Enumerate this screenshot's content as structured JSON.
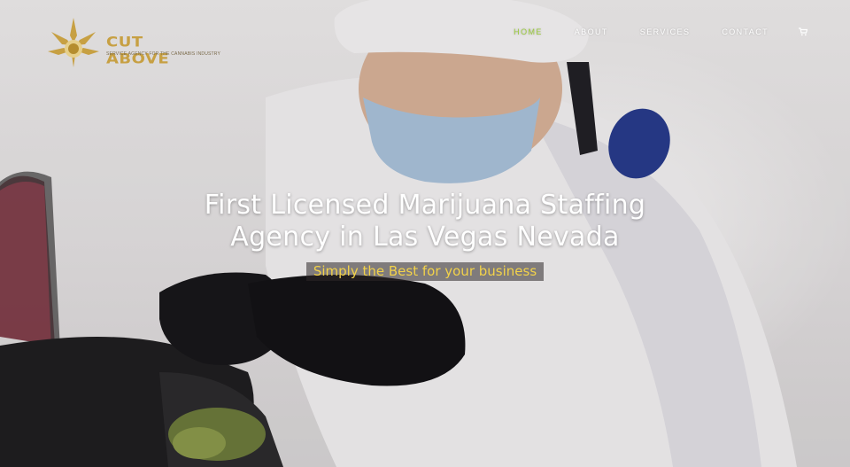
{
  "brand": {
    "name": "CUT ABOVE",
    "tagline": "SERVICE AGENCY FOR THE CANNABIS INDUSTRY",
    "accent": "#c7a043"
  },
  "nav": {
    "items": [
      {
        "label": "HOME",
        "active": true
      },
      {
        "label": "ABOUT",
        "active": false
      },
      {
        "label": "SERVICES",
        "active": false
      },
      {
        "label": "CONTACT",
        "active": false
      }
    ],
    "cart_icon": "cart-icon",
    "active_color": "#9acb3a"
  },
  "hero": {
    "headline_line1": "First Licensed Marijuana Staffing",
    "headline_line2": "Agency in Las Vegas Nevada",
    "subheadline": "Simply the Best for your business",
    "subheadline_color": "#f2d24a"
  }
}
